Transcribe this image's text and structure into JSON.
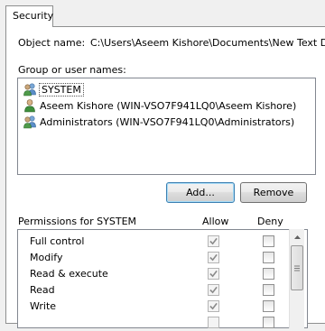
{
  "tab": {
    "label": "Security"
  },
  "object": {
    "label": "Object name:",
    "value": "C:\\Users\\Aseem Kishore\\Documents\\New Text Do"
  },
  "users": {
    "label": "Group or user names:",
    "items": [
      {
        "name": "SYSTEM",
        "icon": "group-users-icon",
        "selected": true
      },
      {
        "name": "Aseem Kishore (WIN-VSO7F941LQ0\\Aseem Kishore)",
        "icon": "user-icon",
        "selected": false
      },
      {
        "name": "Administrators (WIN-VSO7F941LQ0\\Administrators)",
        "icon": "group-users-icon",
        "selected": false
      }
    ]
  },
  "buttons": {
    "add": "Add...",
    "remove": "Remove"
  },
  "permissions": {
    "title": "Permissions for SYSTEM",
    "allow_header": "Allow",
    "deny_header": "Deny",
    "rows": [
      {
        "name": "Full control",
        "allow": true,
        "deny": false
      },
      {
        "name": "Modify",
        "allow": true,
        "deny": false
      },
      {
        "name": "Read & execute",
        "allow": true,
        "deny": false
      },
      {
        "name": "Read",
        "allow": true,
        "deny": false
      },
      {
        "name": "Write",
        "allow": true,
        "deny": false
      }
    ]
  },
  "colors": {
    "selection": "#cce8ff",
    "check": "#8a8a8a"
  }
}
